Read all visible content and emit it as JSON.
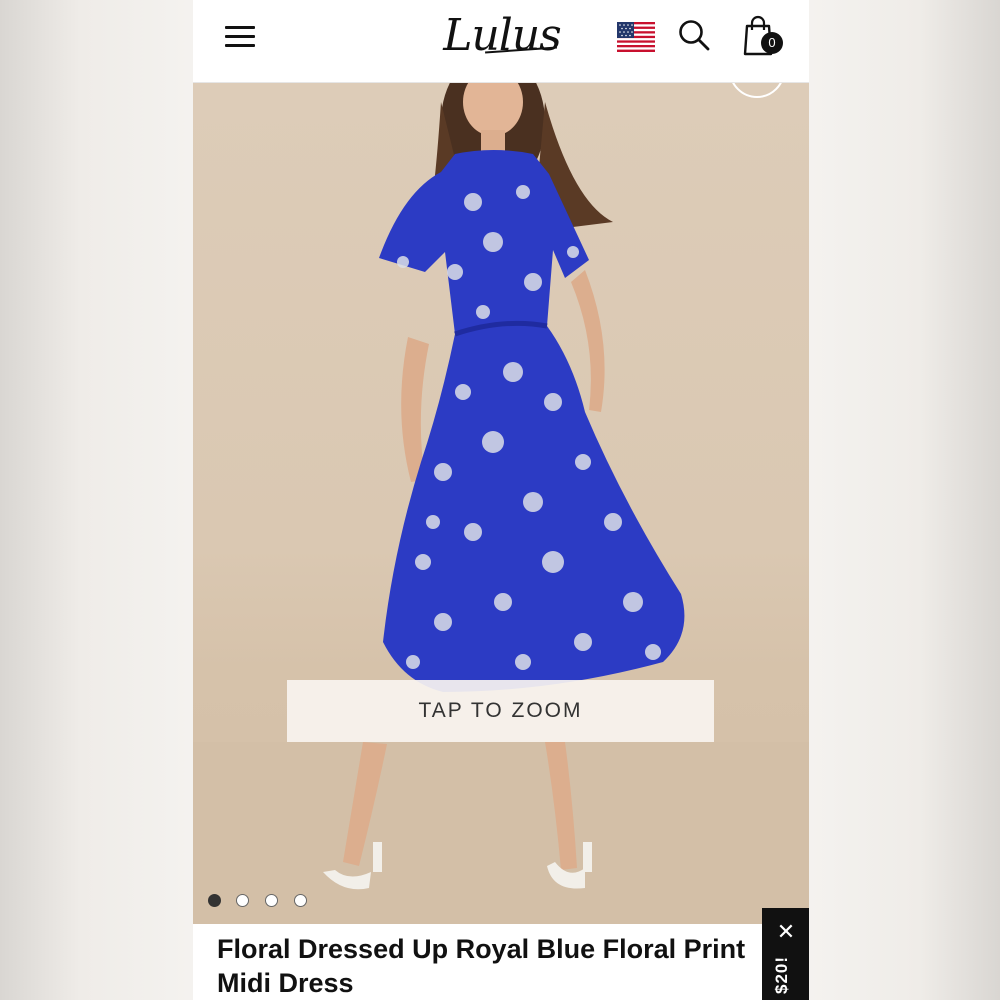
{
  "header": {
    "logo_text": "Lulus",
    "cart_count": "0",
    "icons": {
      "menu": "hamburger-menu-icon",
      "flag": "us-flag-icon",
      "search": "search-icon",
      "cart": "shopping-bag-icon"
    }
  },
  "gallery": {
    "zoom_label": "TAP TO ZOOM",
    "image_count": 4,
    "active_index": 0
  },
  "product": {
    "title": "Floral Dressed Up Royal Blue Floral Print Midi Dress"
  },
  "promo": {
    "label": "$20!",
    "close_symbol": "✕"
  },
  "colors": {
    "dress": "#2c3bc4",
    "backdrop": "#dcc9b4",
    "promo_bg": "#111111"
  }
}
